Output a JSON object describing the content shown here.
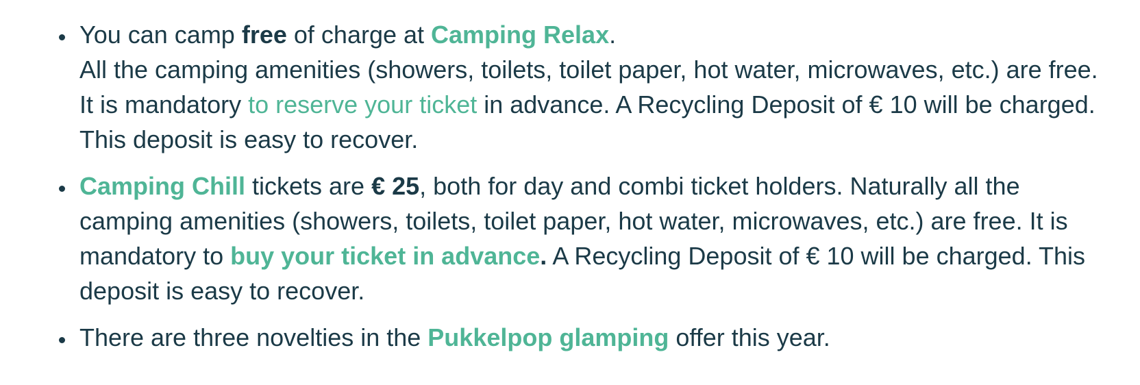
{
  "colors": {
    "text": "#1b3a47",
    "accent": "#4fb596",
    "background": "#ffffff"
  },
  "items": [
    {
      "line1_pre": "You can camp ",
      "line1_bold": "free",
      "line1_mid": " of charge at ",
      "camping_link": "Camping Relax",
      "line1_end": ".",
      "body_pre": "All the camping amenities (showers, toilets, toilet paper, hot water, microwaves, etc.) are free. It is mandatory ",
      "reserve_link": "to reserve your ticket",
      "body_post": " in advance. A Recycling Deposit of € 10 will be charged. This deposit is easy to recover."
    },
    {
      "camping_link": "Camping Chill",
      "text_a": " tickets are ",
      "price": "€ 25",
      "text_b": ", both for day and combi ticket holders. Naturally all the camping amenities (showers, toilets, toilet paper, hot water, microwaves, etc.) are free. It is mandatory to ",
      "buy_link": "buy your ticket in advance",
      "bold_period": ".",
      "text_c": " A Recycling Deposit of € 10 will be charged. This deposit is easy to recover."
    },
    {
      "text_a": "There are three novelties in the ",
      "glamping_link": "Pukkelpop glamping",
      "text_b": " offer this year."
    }
  ]
}
